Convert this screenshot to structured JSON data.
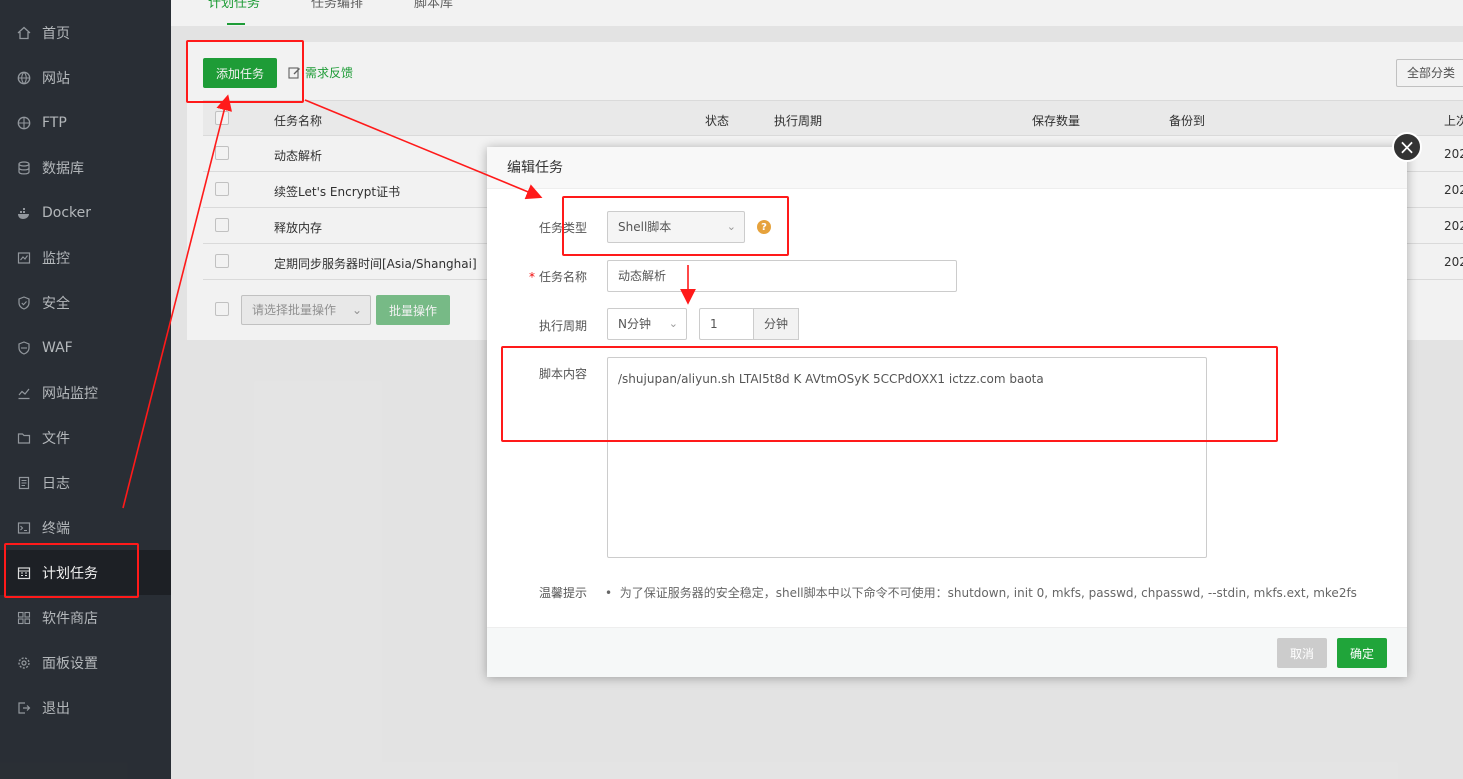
{
  "sidebar": {
    "items": [
      {
        "label": "首页",
        "icon": "home-icon"
      },
      {
        "label": "网站",
        "icon": "globe-icon"
      },
      {
        "label": "FTP",
        "icon": "ftp-icon"
      },
      {
        "label": "数据库",
        "icon": "database-icon"
      },
      {
        "label": "Docker",
        "icon": "docker-icon"
      },
      {
        "label": "监控",
        "icon": "monitor-icon"
      },
      {
        "label": "安全",
        "icon": "shield-icon"
      },
      {
        "label": "WAF",
        "icon": "waf-icon"
      },
      {
        "label": "网站监控",
        "icon": "chart-icon"
      },
      {
        "label": "文件",
        "icon": "folder-icon"
      },
      {
        "label": "日志",
        "icon": "log-icon"
      },
      {
        "label": "终端",
        "icon": "terminal-icon"
      },
      {
        "label": "计划任务",
        "icon": "calendar-icon"
      },
      {
        "label": "软件商店",
        "icon": "grid-icon"
      },
      {
        "label": "面板设置",
        "icon": "gear-icon"
      },
      {
        "label": "退出",
        "icon": "logout-icon"
      }
    ],
    "active_index": 12
  },
  "tabs": [
    "计划任务",
    "任务编排",
    "脚本库"
  ],
  "toolbar": {
    "add_label": "添加任务",
    "feedback_label": "需求反馈",
    "all_category": "全部分类"
  },
  "table": {
    "headers": [
      "任务名称",
      "状态",
      "执行周期",
      "保存数量",
      "备份到",
      "上次"
    ],
    "rows": [
      {
        "name": "动态解析",
        "last": "202"
      },
      {
        "name": "续签Let's Encrypt证书",
        "last": "202"
      },
      {
        "name": "释放内存",
        "last": "202"
      },
      {
        "name": "定期同步服务器时间[Asia/Shanghai]",
        "last": "202"
      }
    ]
  },
  "batch": {
    "select_placeholder": "请选择批量操作",
    "button_label": "批量操作"
  },
  "modal": {
    "title": "编辑任务",
    "close": "×",
    "type_label": "任务类型",
    "type_value": "Shell脚本",
    "help": "?",
    "name_label": "任务名称",
    "name_value": "动态解析",
    "period_label": "执行周期",
    "period_type": "N分钟",
    "period_value": "1",
    "period_unit": "分钟",
    "script_label": "脚本内容",
    "script_value": "/shujupan/aliyun.sh LTAI5t8d                  K AVtmOSyK                  5CCPdOXX1 ictzz.com baota",
    "tip_label": "温馨提示",
    "tip_text": "为了保证服务器的安全稳定，shell脚本中以下命令不可使用：shutdown, init 0, mkfs, passwd, chpasswd, --stdin, mkfs.ext, mke2fs",
    "cancel_label": "取消",
    "ok_label": "确定"
  },
  "colors": {
    "accent": "#20a53a",
    "annotation": "#ff1a1a",
    "sidebar_bg": "#2c3138"
  }
}
